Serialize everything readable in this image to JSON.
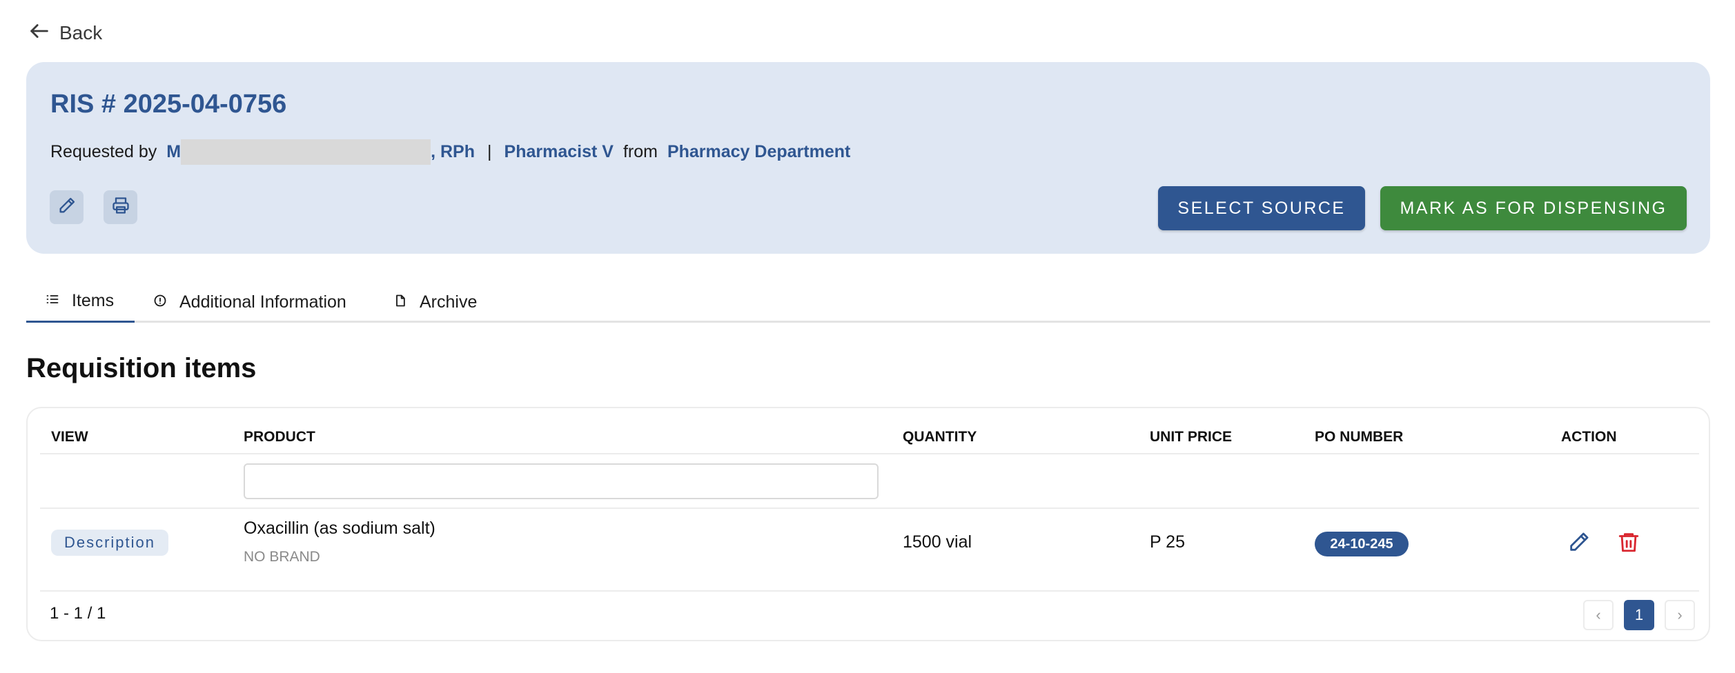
{
  "back": {
    "label": "Back",
    "icon": "arrow-left-icon"
  },
  "header": {
    "title": "RIS # 2025-04-0756",
    "requested_by_label": "Requested by",
    "requester_prefix": "M",
    "requester_suffix": ", RPh",
    "separator": "|",
    "position": "Pharmacist V",
    "from_label": "from",
    "department": "Pharmacy Department",
    "edit_icon": "pencil-icon",
    "print_icon": "printer-icon",
    "select_source_label": "SELECT SOURCE",
    "mark_dispensing_label": "MARK AS FOR DISPENSING"
  },
  "tabs": [
    {
      "label": "Items",
      "icon": "list-icon",
      "active": true
    },
    {
      "label": "Additional Information",
      "icon": "info-circle-icon",
      "active": false
    },
    {
      "label": "Archive",
      "icon": "file-icon",
      "active": false
    }
  ],
  "section": {
    "title": "Requisition items"
  },
  "table": {
    "columns": [
      "VIEW",
      "PRODUCT",
      "QUANTITY",
      "UNIT PRICE",
      "PO NUMBER",
      "ACTION"
    ],
    "filter": {
      "value": "",
      "placeholder": ""
    },
    "rows": [
      {
        "view_label": "Description",
        "product_name": "Oxacillin (as sodium salt)",
        "brand": "NO BRAND",
        "quantity": "1500 vial",
        "unit_price": "P 25",
        "po_number": "24-10-245"
      }
    ],
    "range_text": "1 - 1 / 1",
    "pagination": {
      "prev": "‹",
      "current": "1",
      "next": "›"
    }
  },
  "colors": {
    "primary": "#2f5691",
    "success": "#3e8a3d",
    "danger": "#d9262f",
    "header_bg": "#dfe7f3"
  }
}
